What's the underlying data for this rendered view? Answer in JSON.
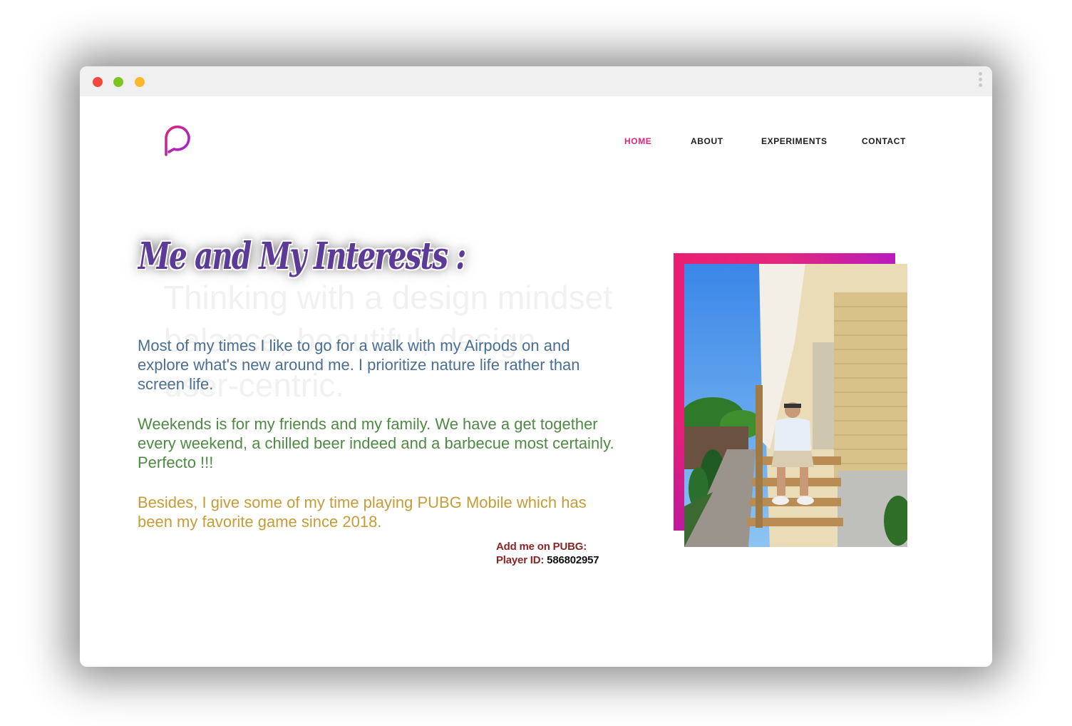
{
  "nav": {
    "items": [
      {
        "label": "HOME",
        "active": true
      },
      {
        "label": "ABOUT",
        "active": false
      },
      {
        "label": "EXPERIMENTS",
        "active": false
      },
      {
        "label": "CONTACT",
        "active": false
      }
    ]
  },
  "hero": {
    "heading": "Me and My Interests :",
    "paragraphs": [
      "Most of my times I like to go for a walk with my Airpods on and explore what's new around me. I prioritize nature life rather than screen life.",
      "Weekends is for my friends and my family. We have a get together every weekend, a chilled beer indeed and a barbecue most certainly. Perfecto !!!",
      "Besides, I give some of my time playing PUBG Mobile which has been my favorite game since 2018."
    ],
    "pubg": {
      "add_label": "Add me on PUBG:",
      "player_label": "Player ID:",
      "player_id": "586802957"
    }
  },
  "ghost_text": [
    "Thinking with a design mindset",
    "balance, beautiful, design",
    "user-centric."
  ],
  "colors": {
    "accent": "#e0257a",
    "heading": "#5c3b98",
    "paragraph_1": "#4a6f93",
    "paragraph_2": "#4e8a43",
    "paragraph_3": "#c69c38",
    "pubg_label": "#8b2626",
    "frame_gradient_start": "#e91f73",
    "frame_gradient_end": "#b81bbd"
  },
  "icons": {
    "logo": "chat-bubble-logo-icon",
    "window_controls": [
      "close-dot-icon",
      "maximize-dot-icon",
      "minimize-dot-icon"
    ],
    "menu": "kebab-menu-icon"
  }
}
